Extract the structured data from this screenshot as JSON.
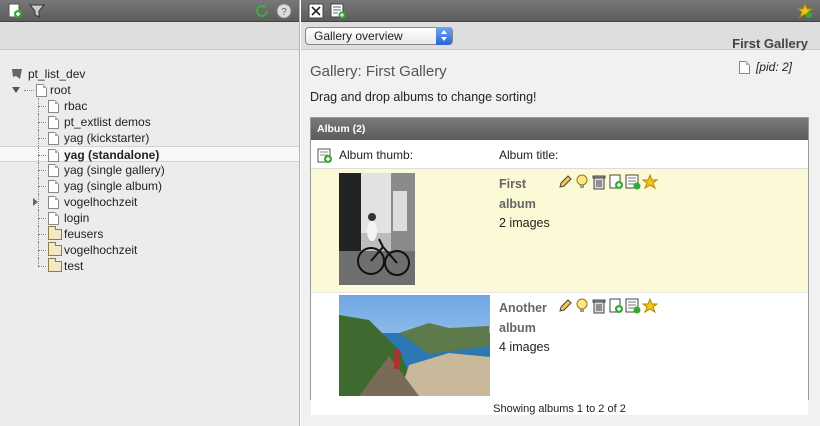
{
  "left_tree": {
    "root_site": "pt_list_dev",
    "root_node": "root",
    "items": [
      {
        "label": "rbac",
        "type": "page"
      },
      {
        "label": "pt_extlist demos",
        "type": "page"
      },
      {
        "label": "yag (kickstarter)",
        "type": "page"
      },
      {
        "label": "yag (standalone)",
        "type": "page",
        "selected": true
      },
      {
        "label": "yag (single gallery)",
        "type": "page"
      },
      {
        "label": "yag (single album)",
        "type": "page"
      },
      {
        "label": "vogelhochzeit",
        "type": "page",
        "expandable": true
      },
      {
        "label": "login",
        "type": "page"
      },
      {
        "label": "feusers",
        "type": "folder"
      },
      {
        "label": "vogelhochzeit",
        "type": "folder"
      },
      {
        "label": "test",
        "type": "folder"
      }
    ]
  },
  "right": {
    "view_select": "Gallery overview",
    "page_heading": "First Gallery",
    "gallery_title": "Gallery: First Gallery",
    "pid_label": "[pid: 2]",
    "instruction": "Drag and drop albums to change sorting!",
    "album_header": "Album (2)",
    "col_thumb": "Album thumb:",
    "col_title": "Album title:",
    "albums": [
      {
        "name": "First album",
        "count": "2 images"
      },
      {
        "name": "Another album",
        "count": "4 images"
      }
    ],
    "footer": "Showing albums 1 to 2 of 2"
  },
  "colors": {
    "toolbar": "#666666",
    "selected_row_bg": "#fbf9d6",
    "accent_blue": "#2964d9"
  }
}
